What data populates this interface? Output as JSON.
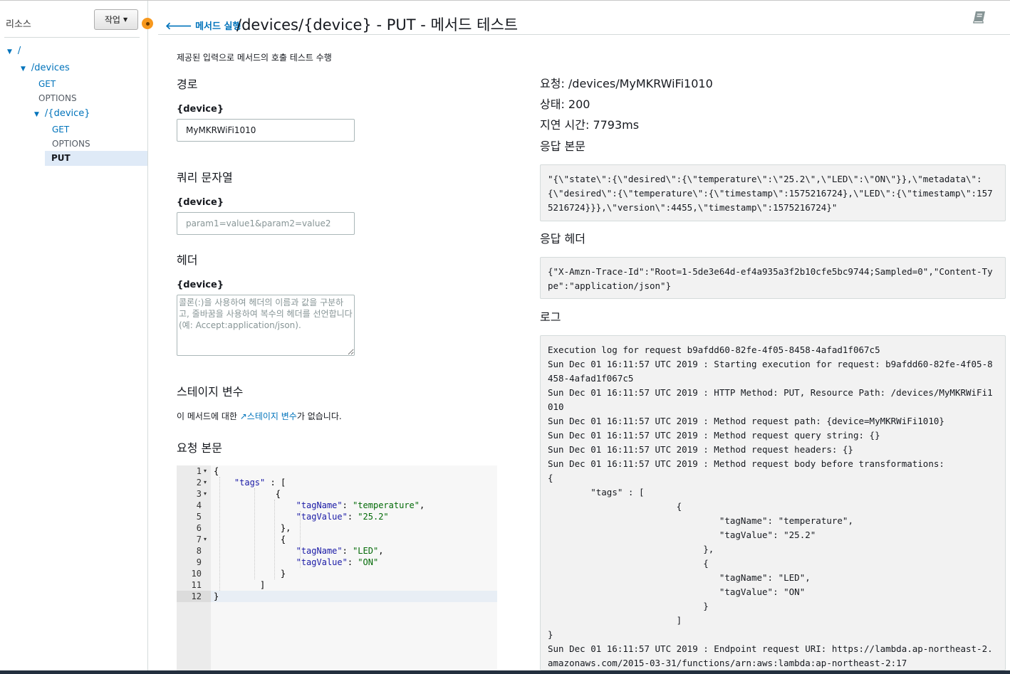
{
  "sidebar": {
    "title": "리소스",
    "actions_label": "작업",
    "tree": {
      "root": "/",
      "devices": "/devices",
      "devices_get": "GET",
      "devices_options": "OPTIONS",
      "device": "/{device}",
      "device_get": "GET",
      "device_options": "OPTIONS",
      "device_put": "PUT"
    }
  },
  "header": {
    "back_label": "메서드 실행",
    "title": "/devices/{device} - PUT - 메서드 테스트"
  },
  "form": {
    "intro": "제공된 입력으로 메서드의 호출 테스트 수행",
    "path_section": "경로",
    "path_param_label": "{device}",
    "path_param_value": "MyMKRWiFi1010",
    "query_section": "쿼리 문자열",
    "query_param_label": "{device}",
    "query_placeholder": "param1=value1&param2=value2",
    "headers_section": "헤더",
    "headers_param_label": "{device}",
    "headers_placeholder": "콜론(:)을 사용하여 헤더의 이름과 값을 구분하고, 줄바꿈을 사용하여 복수의 헤더를 선언합니다(예: Accept:application/json).",
    "stage_section": "스테이지 변수",
    "stage_text_before": "이 메서드에 대한 ",
    "stage_link": "스테이지 변수",
    "stage_text_after": "가 없습니다.",
    "body_section": "요청 본문"
  },
  "request_body_lines": [
    "{",
    "    \"tags\" : [",
    "            {",
    "                \"tagName\": \"temperature\",",
    "                \"tagValue\": \"25.2\"",
    "             },",
    "             {",
    "                \"tagName\": \"LED\",",
    "                \"tagValue\": \"ON\"",
    "             }",
    "         ]",
    "}"
  ],
  "line_numbers": [
    "1",
    "2",
    "3",
    "4",
    "5",
    "6",
    "7",
    "8",
    "9",
    "10",
    "11",
    "12"
  ],
  "result": {
    "request": "요청: /devices/MyMKRWiFi1010",
    "status": "상태: 200",
    "latency": "지연 시간: 7793ms",
    "response_body_label": "응답 본문",
    "response_body": "\"{\\\"state\\\":{\\\"desired\\\":{\\\"temperature\\\":\\\"25.2\\\",\\\"LED\\\":\\\"ON\\\"}},\\\"metadata\\\":{\\\"desired\\\":{\\\"temperature\\\":{\\\"timestamp\\\":1575216724},\\\"LED\\\":{\\\"timestamp\\\":1575216724}}},\\\"version\\\":4455,\\\"timestamp\\\":1575216724}\"",
    "response_headers_label": "응답 헤더",
    "response_headers": "{\"X-Amzn-Trace-Id\":\"Root=1-5de3e64d-ef4a935a3f2b10cfe5bc9744;Sampled=0\",\"Content-Type\":\"application/json\"}",
    "logs_label": "로그",
    "logs": "Execution log for request b9afdd60-82fe-4f05-8458-4afad1f067c5\nSun Dec 01 16:11:57 UTC 2019 : Starting execution for request: b9afdd60-82fe-4f05-8458-4afad1f067c5\nSun Dec 01 16:11:57 UTC 2019 : HTTP Method: PUT, Resource Path: /devices/MyMKRWiFi1010\nSun Dec 01 16:11:57 UTC 2019 : Method request path: {device=MyMKRWiFi1010}\nSun Dec 01 16:11:57 UTC 2019 : Method request query string: {}\nSun Dec 01 16:11:57 UTC 2019 : Method request headers: {}\nSun Dec 01 16:11:57 UTC 2019 : Method request body before transformations:\n{\n        \"tags\" : [\n                        {\n                                \"tagName\": \"temperature\",\n                                \"tagValue\": \"25.2\"\n                             },\n                             {\n                                \"tagName\": \"LED\",\n                                \"tagValue\": \"ON\"\n                             }\n                        ]\n}\nSun Dec 01 16:11:57 UTC 2019 : Endpoint request URI: https://lambda.ap-northeast-2.amazonaws.com/2015-03-31/functions/arn:aws:lambda:ap-northeast-2:17"
  }
}
